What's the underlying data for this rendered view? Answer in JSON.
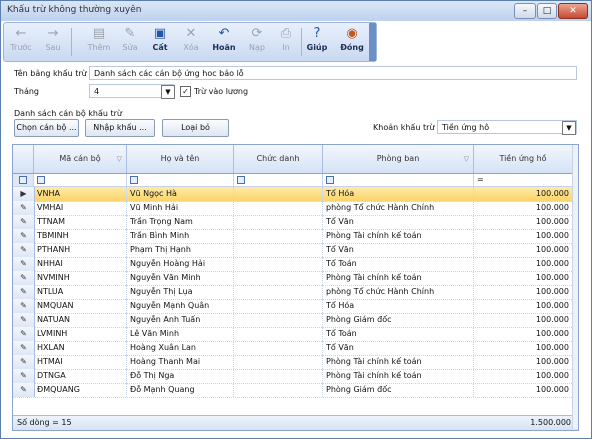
{
  "window": {
    "title": "Khấu trừ không thường xuyên",
    "min_label": "–",
    "max_label": "□",
    "close_label": "✕"
  },
  "toolbar": [
    {
      "name": "back-button",
      "icon": "arrow-left-icon",
      "glyph": "←",
      "label": "Trước",
      "enabled": false
    },
    {
      "name": "next-button",
      "icon": "arrow-right-icon",
      "glyph": "→",
      "label": "Sau",
      "enabled": false
    },
    {
      "name": "add-button",
      "icon": "add-doc-icon",
      "glyph": "▤",
      "label": "Thêm",
      "enabled": false
    },
    {
      "name": "edit-button",
      "icon": "edit-doc-icon",
      "glyph": "✎",
      "label": "Sửa",
      "enabled": false
    },
    {
      "name": "save-button",
      "icon": "floppy-icon",
      "glyph": "▣",
      "label": "Cất",
      "enabled": true
    },
    {
      "name": "delete-button",
      "icon": "delete-icon",
      "glyph": "✕",
      "label": "Xóa",
      "enabled": false
    },
    {
      "name": "undo-button",
      "icon": "undo-icon",
      "glyph": "↶",
      "label": "Hoãn",
      "enabled": true
    },
    {
      "name": "reload-button",
      "icon": "reload-icon",
      "glyph": "⟳",
      "label": "Nạp",
      "enabled": false
    },
    {
      "name": "print-button",
      "icon": "printer-icon",
      "glyph": "⎙",
      "label": "In",
      "enabled": false
    },
    {
      "name": "help-button",
      "icon": "help-icon",
      "glyph": "?",
      "label": "Giúp",
      "enabled": true
    },
    {
      "name": "close-button",
      "icon": "close-icon",
      "glyph": "◉",
      "label": "Đóng",
      "enabled": true
    }
  ],
  "form": {
    "name_label": "Tên bảng khấu trừ",
    "name_value": "Danh sách các cán bộ ứng hoc bảo lỗ",
    "month_label": "Tháng",
    "month_value": "4",
    "deduct_label": "Trừ vào lương",
    "deduct_checked": true,
    "list_label": "Danh sách cán bộ khấu trừ",
    "choose_button": "Chọn cán bộ ...",
    "enter_button": "Nhập khấu ...",
    "remove_button": "Loại bỏ",
    "type_label": "Khoản khấu trừ",
    "type_value": "Tiền ứng hô"
  },
  "grid": {
    "columns": [
      "Mã cán bộ",
      "Họ và tên",
      "Chức danh",
      "Phòng ban",
      "Tiền ứng hồ"
    ],
    "filter_equals": "=",
    "rows": [
      {
        "code": "VNHA",
        "name": "Vũ Ngọc Hà",
        "title": "",
        "dept": "Tổ Hóa",
        "amount": "100.000",
        "selected": true
      },
      {
        "code": "VMHAI",
        "name": "Vũ Minh Hải",
        "title": "",
        "dept": "phòng Tổ chức Hành Chính",
        "amount": "100.000"
      },
      {
        "code": "TTNAM",
        "name": "Trần Trọng Nam",
        "title": "",
        "dept": "Tổ Văn",
        "amount": "100.000"
      },
      {
        "code": "TBMINH",
        "name": "Trần Bình Minh",
        "title": "",
        "dept": "Phòng Tài chính kế toán",
        "amount": "100.000"
      },
      {
        "code": "PTHANH",
        "name": "Phạm Thị Hạnh",
        "title": "",
        "dept": "Tổ Văn",
        "amount": "100.000"
      },
      {
        "code": "NHHAI",
        "name": "Nguyễn Hoàng Hải",
        "title": "",
        "dept": "Tổ Toán",
        "amount": "100.000"
      },
      {
        "code": "NVMINH",
        "name": "Nguyễn Văn Minh",
        "title": "",
        "dept": "Phòng Tài chính kế toán",
        "amount": "100.000"
      },
      {
        "code": "NTLUA",
        "name": "Nguyễn Thị Lụa",
        "title": "",
        "dept": "phòng Tổ chức Hành Chính",
        "amount": "100.000"
      },
      {
        "code": "NMQUAN",
        "name": "Nguyễn Mạnh Quân",
        "title": "",
        "dept": "Tổ Hóa",
        "amount": "100.000"
      },
      {
        "code": "NATUAN",
        "name": "Nguyễn Anh Tuấn",
        "title": "",
        "dept": "Phòng Giám đốc",
        "amount": "100.000"
      },
      {
        "code": "LVMINH",
        "name": "Lê Văn Minh",
        "title": "",
        "dept": "Tổ Toán",
        "amount": "100.000"
      },
      {
        "code": "HXLAN",
        "name": "Hoàng Xuân Lan",
        "title": "",
        "dept": "Tổ Văn",
        "amount": "100.000"
      },
      {
        "code": "HTMAI",
        "name": "Hoàng Thanh Mai",
        "title": "",
        "dept": "Phòng Tài chính kế toán",
        "amount": "100.000"
      },
      {
        "code": "DTNGA",
        "name": "Đỗ Thị Nga",
        "title": "",
        "dept": "Phòng Tài chính kế toán",
        "amount": "100.000"
      },
      {
        "code": "ĐMQUANG",
        "name": "Đỗ Mạnh Quang",
        "title": "",
        "dept": "Phòng Giám đốc",
        "amount": "100.000"
      }
    ],
    "footer_count": "Số dòng = 15",
    "footer_total": "1.500.000"
  }
}
